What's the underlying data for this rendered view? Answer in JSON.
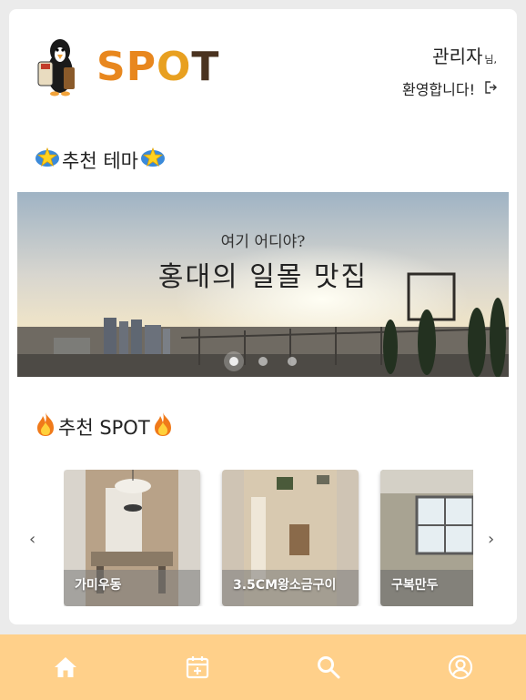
{
  "header": {
    "logo_text": "SPOT",
    "user_name": "관리자",
    "user_suffix": "님,",
    "welcome": "환영합니다!"
  },
  "theme_section": {
    "title": "추천 테마",
    "banner_subtitle": "여기 어디야?",
    "banner_title": "홍대의 일몰 맛집",
    "slide_count": 3,
    "active_slide": 1
  },
  "spot_section": {
    "title": "추천 SPOT",
    "items": [
      {
        "label": "가미우동"
      },
      {
        "label": "3.5CM왕소금구이"
      },
      {
        "label": "구복만두"
      }
    ]
  },
  "nav": {
    "items": [
      "home-icon",
      "calendar-add-icon",
      "search-icon",
      "profile-icon"
    ]
  },
  "colors": {
    "nav_bg": "#ffd08a",
    "logo_orange": "#e8871e",
    "logo_brown": "#5a3a1a",
    "icon_white": "#ffffff"
  }
}
